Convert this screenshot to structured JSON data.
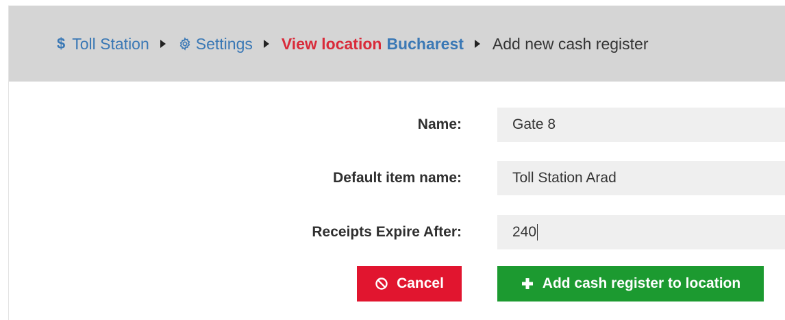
{
  "breadcrumb": {
    "home_icon": "dollar-icon",
    "home_label": "Toll Station",
    "settings_icon": "gear-icon",
    "settings_label": "Settings",
    "view_location_prefix": "View location",
    "view_location_name": "Bucharest",
    "current": "Add new cash register"
  },
  "form": {
    "name_label": "Name:",
    "name_value": "Gate 8",
    "default_item_label": "Default item name:",
    "default_item_value": "Toll Station Arad",
    "receipts_expire_label": "Receipts Expire After:",
    "receipts_expire_value": "240"
  },
  "actions": {
    "cancel_icon": "ban-icon",
    "cancel_label": "Cancel",
    "add_icon": "plus-icon",
    "add_label": "Add cash register to location"
  },
  "colors": {
    "link": "#3a78b5",
    "accent_red": "#d92b3a",
    "cancel_button": "#e1152f",
    "add_button": "#1c9a30",
    "breadcrumb_bar": "#d5d5d5",
    "input_bg": "#efefef"
  }
}
